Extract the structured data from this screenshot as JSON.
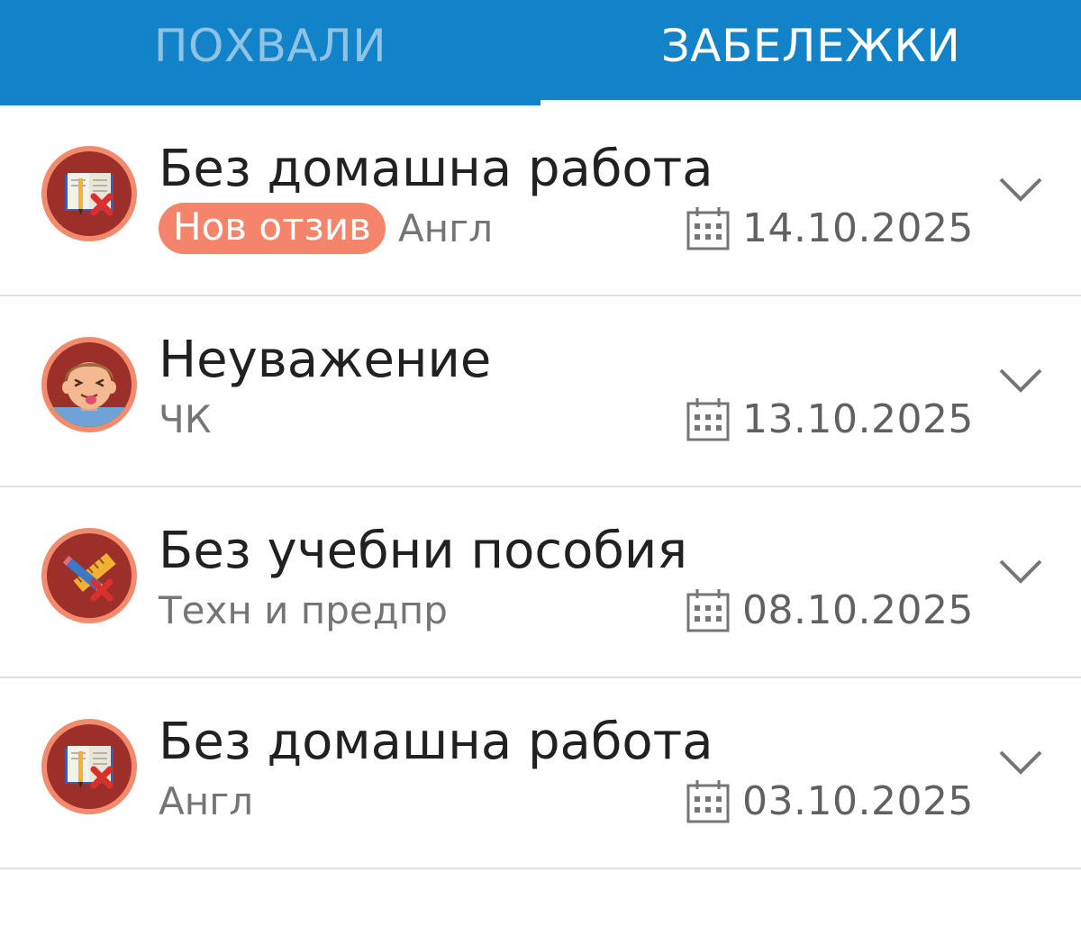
{
  "tabs": {
    "praises": "ПОХВАЛИ",
    "remarks": "ЗАБЕЛЕЖКИ"
  },
  "remarks": [
    {
      "icon": "book-cross-icon",
      "title": "Без домашна работа",
      "badge": "Нов отзив",
      "subject": "Англ",
      "date": "14.10.2025"
    },
    {
      "icon": "boy-tongue-icon",
      "title": "Неуважение",
      "badge": "",
      "subject": "ЧК",
      "date": "13.10.2025"
    },
    {
      "icon": "pencil-ruler-cross-icon",
      "title": "Без учебни пособия",
      "badge": "",
      "subject": "Техн и предпр",
      "date": "08.10.2025"
    },
    {
      "icon": "book-cross-icon",
      "title": "Без домашна работа",
      "badge": "",
      "subject": "Англ",
      "date": "03.10.2025"
    }
  ],
  "colors": {
    "tab_bar": "#1283c8",
    "badge": "#f4856a",
    "avatar_ring": "#f28a6c",
    "avatar_fill": "#9c2f2a"
  }
}
